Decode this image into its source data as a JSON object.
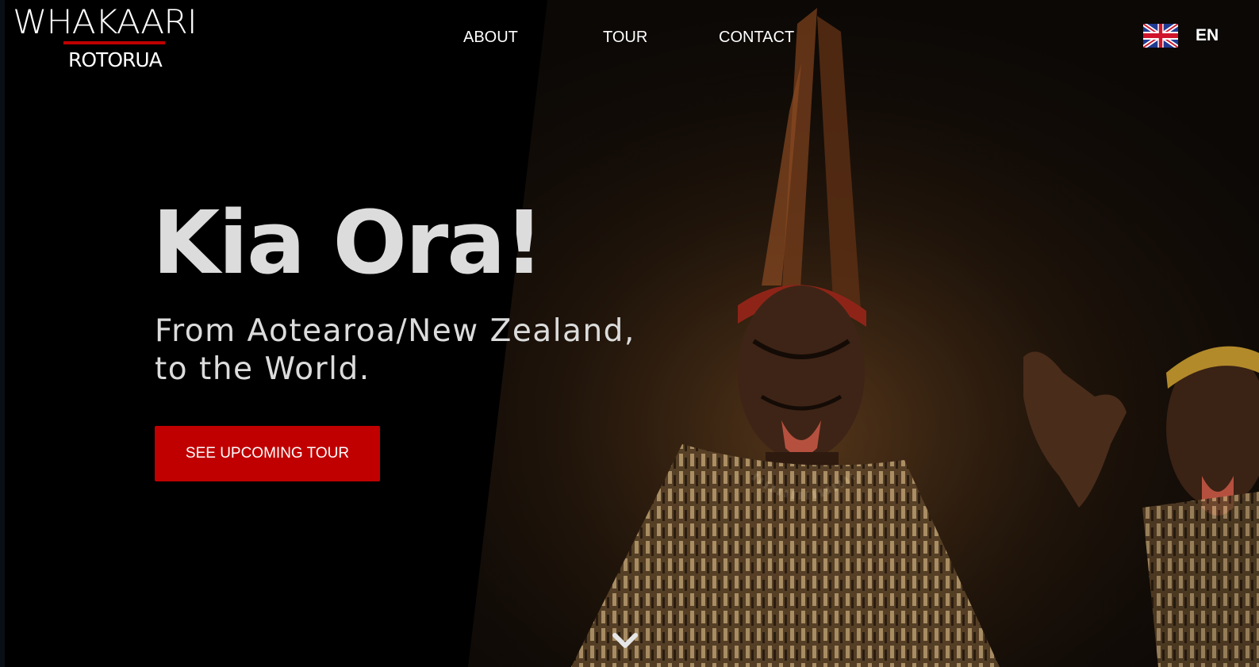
{
  "brand": {
    "name_top": "WHAKAARI",
    "name_bottom": "ROTORUA",
    "accent_color": "#c00000"
  },
  "nav": {
    "items": [
      {
        "label": "ABOUT"
      },
      {
        "label": "TOUR"
      },
      {
        "label": "CONTACT"
      }
    ]
  },
  "language": {
    "label": "EN",
    "flag_icon": "uk-flag-icon"
  },
  "hero": {
    "headline": "Kia Ora!",
    "subline_1": "From Aotearoa/New Zealand,",
    "subline_2": "to the World.",
    "cta_label": "SEE UPCOMING TOUR",
    "scroll_icon": "chevron-down-icon",
    "image_subject": "Māori performers in traditional dress performing a haka with moko face markings"
  }
}
